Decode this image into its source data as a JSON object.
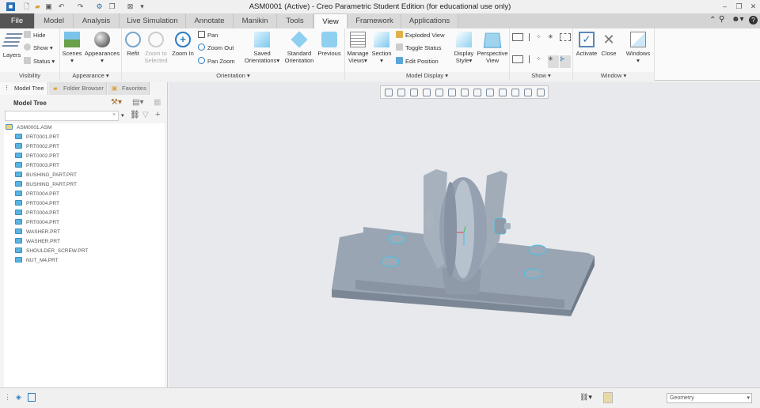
{
  "window": {
    "title": "ASM0001 (Active) - Creo Parametric Student Edition (for educational use only)",
    "controls": [
      "minimize",
      "restore",
      "close"
    ]
  },
  "quick_access": [
    "app-icon",
    "new-icon",
    "open-icon",
    "save-icon",
    "undo-icon",
    "redo-icon",
    "regenerate-icon",
    "windows-icon",
    "close-window-icon",
    "customize-icon"
  ],
  "tabs": [
    "File",
    "Model",
    "Analysis",
    "Live Simulation",
    "Annotate",
    "Manikin",
    "Tools",
    "View",
    "Framework",
    "Applications"
  ],
  "active_tab": "View",
  "ribbon": {
    "visibility": {
      "label": "Visibility",
      "layers": "Layers",
      "hide": "Hide",
      "show": "Show",
      "status": "Status"
    },
    "appearance": {
      "label": "Appearance",
      "scenes": "Scenes",
      "appearances": "Appearances"
    },
    "orientation": {
      "label": "Orientation",
      "refit": "Refit",
      "zoom_selected_1": "Zoom to",
      "zoom_selected_2": "Selected",
      "zoom_in": "Zoom In",
      "pan": "Pan",
      "zoom_out": "Zoom Out",
      "pan_zoom": "Pan Zoom",
      "saved_1": "Saved",
      "saved_2": "Orientations",
      "standard_1": "Standard",
      "standard_2": "Orientation",
      "previous": "Previous"
    },
    "model_display": {
      "label": "Model Display",
      "manage_1": "Manage",
      "manage_2": "Views",
      "section": "Section",
      "exploded": "Exploded View",
      "toggle": "Toggle Status",
      "edit_position": "Edit Position",
      "display_1": "Display",
      "display_2": "Style",
      "perspective_1": "Perspective",
      "perspective_2": "View"
    },
    "show": {
      "label": "Show"
    },
    "window": {
      "label": "Window",
      "activate": "Activate",
      "close": "Close",
      "windows": "Windows"
    }
  },
  "panel": {
    "tabs": [
      "Model Tree",
      "Folder Browser",
      "Favorites"
    ],
    "heading": "Model Tree",
    "search": {
      "value": "",
      "placeholder": ""
    },
    "root": "ASM0001.ASM",
    "items": [
      "PRT0001.PRT",
      "PRT0002.PRT",
      "PRT0002.PRT",
      "PRT0003.PRT",
      "BUSHING_PART.PRT",
      "BUSHING_PART.PRT",
      "PRT0004.PRT",
      "PRT0004.PRT",
      "PRT0004.PRT",
      "PRT0004.PRT",
      "WASHER.PRT",
      "WASHER.PRT",
      "SHOULDER_SCREW.PRT",
      "NUT_M4.PRT"
    ]
  },
  "status_bar": {
    "filter": "Geometry"
  },
  "colors": {
    "model": "#9aa6b4",
    "viewport": "#e7e9ed",
    "file_tab": "#555555",
    "edge_highlight": "#3ec3e8"
  }
}
